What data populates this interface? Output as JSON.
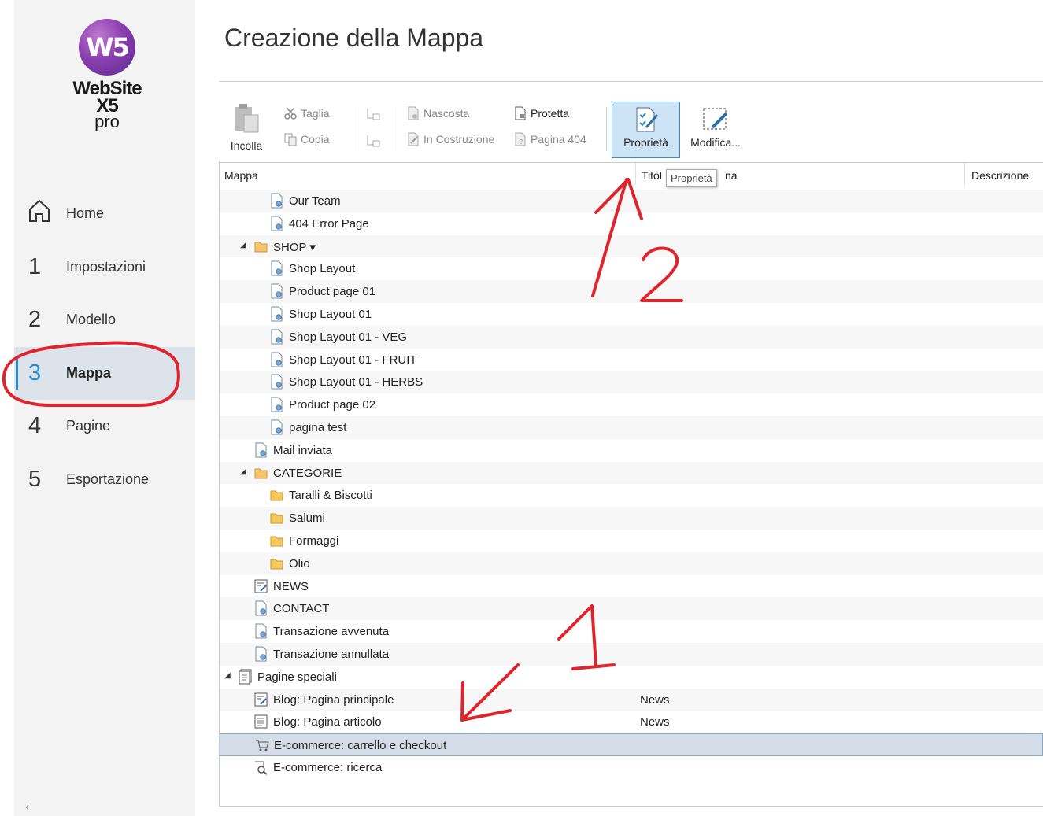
{
  "app": {
    "brand": "WebSite X5",
    "brand_sub": "pro",
    "logo_mark": "W5"
  },
  "page_title": "Creazione della Mappa",
  "nav": [
    {
      "num": "",
      "label": "Home",
      "icon": "home-icon"
    },
    {
      "num": "1",
      "label": "Impostazioni"
    },
    {
      "num": "2",
      "label": "Modello"
    },
    {
      "num": "3",
      "label": "Mappa",
      "active": true
    },
    {
      "num": "4",
      "label": "Pagine"
    },
    {
      "num": "5",
      "label": "Esportazione"
    }
  ],
  "collapse_glyph": "‹",
  "toolbar": {
    "paste": "Incolla",
    "cut": "Taglia",
    "copy": "Copia",
    "hidden": "Nascosta",
    "under_construction": "In Costruzione",
    "protected": "Protetta",
    "page404": "Pagina 404",
    "properties": "Proprietà",
    "edit": "Modifica..."
  },
  "columns": {
    "map": "Mappa",
    "title": "Titol",
    "title_rest": "na",
    "description": "Descrizione"
  },
  "tooltip": "Proprietà",
  "rows": [
    {
      "label": "Our Team",
      "indent": 2,
      "icon": "page"
    },
    {
      "label": "404 Error Page",
      "indent": 2,
      "icon": "page"
    },
    {
      "label": "SHOP ▾",
      "indent": 1,
      "icon": "folder-open",
      "expander": true
    },
    {
      "label": "Shop Layout",
      "indent": 2,
      "icon": "page"
    },
    {
      "label": "Product page 01",
      "indent": 2,
      "icon": "page"
    },
    {
      "label": "Shop Layout 01",
      "indent": 2,
      "icon": "page"
    },
    {
      "label": "Shop Layout 01 - VEG",
      "indent": 2,
      "icon": "page"
    },
    {
      "label": "Shop Layout 01 - FRUIT",
      "indent": 2,
      "icon": "page"
    },
    {
      "label": "Shop Layout 01 - HERBS",
      "indent": 2,
      "icon": "page"
    },
    {
      "label": "Product page 02",
      "indent": 2,
      "icon": "page"
    },
    {
      "label": "pagina test",
      "indent": 2,
      "icon": "page"
    },
    {
      "label": "Mail inviata",
      "indent": 1,
      "icon": "page"
    },
    {
      "label": "CATEGORIE",
      "indent": 1,
      "icon": "folder-open",
      "expander": true
    },
    {
      "label": "Taralli & Biscotti",
      "indent": 2,
      "icon": "folder"
    },
    {
      "label": "Salumi",
      "indent": 2,
      "icon": "folder"
    },
    {
      "label": "Formaggi",
      "indent": 2,
      "icon": "folder"
    },
    {
      "label": "Olio",
      "indent": 2,
      "icon": "folder"
    },
    {
      "label": "NEWS",
      "indent": 1,
      "icon": "blog"
    },
    {
      "label": "CONTACT",
      "indent": 1,
      "icon": "page"
    },
    {
      "label": "Transazione avvenuta",
      "indent": 1,
      "icon": "page"
    },
    {
      "label": "Transazione annullata",
      "indent": 1,
      "icon": "page"
    },
    {
      "label": "Pagine speciali",
      "indent": 0,
      "icon": "special",
      "expander": true
    },
    {
      "label": "Blog: Pagina principale",
      "indent": 1,
      "icon": "blog",
      "title": "News"
    },
    {
      "label": "Blog: Pagina articolo",
      "indent": 1,
      "icon": "article",
      "title": "News"
    },
    {
      "label": "E-commerce: carrello e checkout",
      "indent": 1,
      "icon": "cart",
      "selected": true
    },
    {
      "label": "E-commerce: ricerca",
      "indent": 1,
      "icon": "search"
    }
  ],
  "annotations": {
    "arrow1_label": "1",
    "arrow2_label": "2",
    "ink_color": "#e0242e"
  },
  "colors": {
    "accent": "#2b8ec8",
    "selected_row": "#d4dde7",
    "button_active": "#cde4f7"
  }
}
